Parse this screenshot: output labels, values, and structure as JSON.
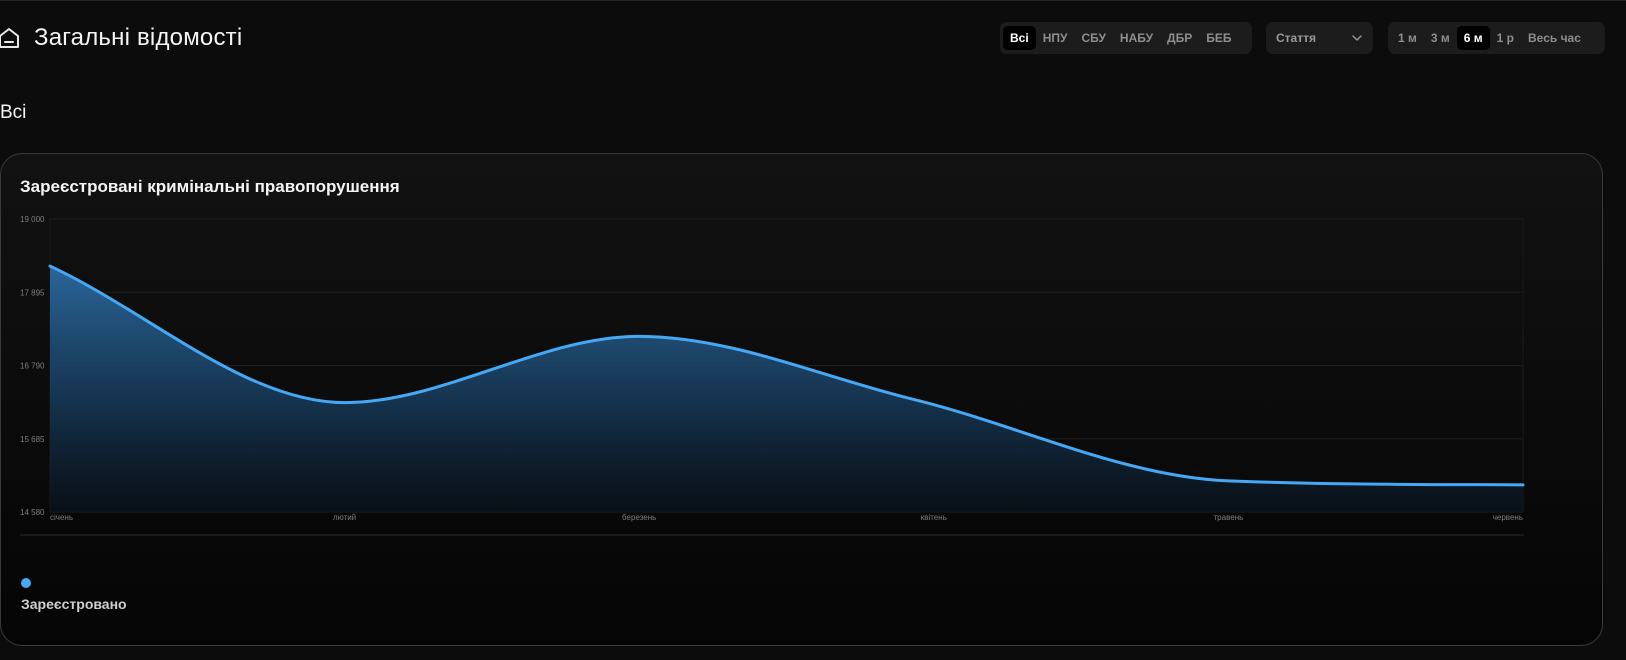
{
  "header": {
    "home_icon": "home-icon",
    "title": "Загальні відомості",
    "agencies": [
      {
        "label": "Всі",
        "active": true
      },
      {
        "label": "НПУ",
        "active": false
      },
      {
        "label": "СБУ",
        "active": false
      },
      {
        "label": "НАБУ",
        "active": false
      },
      {
        "label": "ДБР",
        "active": false
      },
      {
        "label": "БЕБ",
        "active": false
      }
    ],
    "article_select": {
      "value": "Стаття",
      "icon": "chevron-down-icon"
    },
    "periods": [
      {
        "label": "1 м",
        "active": false
      },
      {
        "label": "3 м",
        "active": false
      },
      {
        "label": "6 м",
        "active": true
      },
      {
        "label": "1 р",
        "active": false
      },
      {
        "label": "Весь час",
        "active": false
      }
    ]
  },
  "section_title": "Всі",
  "card": {
    "title": "Зареєстровані кримінальні правопорушення",
    "legend": [
      {
        "name": "Зареєстровано",
        "color": "#46a8f5"
      }
    ]
  },
  "chart_data": {
    "type": "area",
    "categories": [
      "січень",
      "лютий",
      "березень",
      "квітень",
      "травень",
      "червень"
    ],
    "y_ticks": [
      "14 580",
      "15 685",
      "16 790",
      "17 895",
      "19 000"
    ],
    "ylim": [
      14580,
      19000
    ],
    "grid": true,
    "series": [
      {
        "name": "Зареєстровано",
        "color": "#46a8f5",
        "values": [
          18290,
          16230,
          17230,
          16280,
          15050,
          14990
        ]
      }
    ],
    "x_points": [
      0,
      1,
      2,
      2.93,
      4,
      5
    ]
  }
}
